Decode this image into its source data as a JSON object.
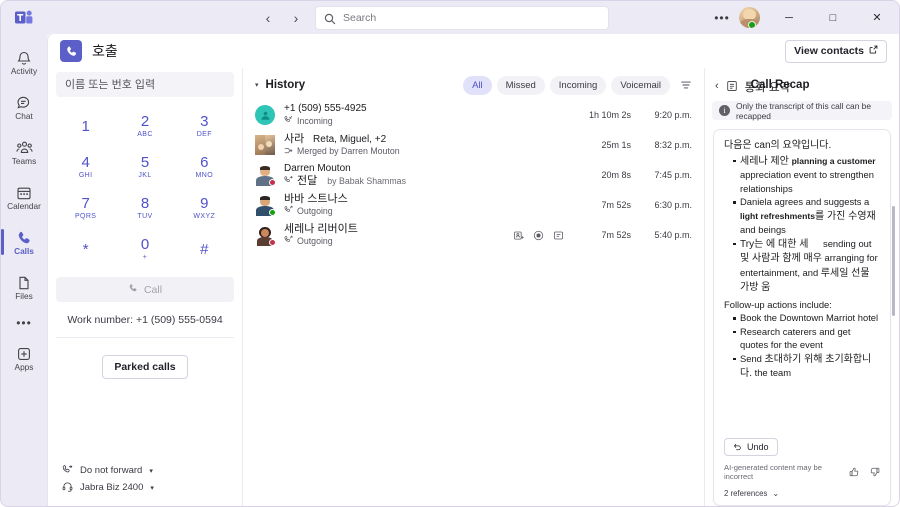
{
  "titlebar": {
    "logo_name": "teams-logo",
    "back_label": "‹",
    "forward_label": "›",
    "search_placeholder": "Search",
    "search_value": "",
    "ellipsis_label": "•••",
    "minimize_label": "─",
    "maximize_label": "□",
    "close_label": "✕"
  },
  "rail": {
    "items": [
      {
        "label": "Activity",
        "icon": "bell-icon",
        "active": false
      },
      {
        "label": "Chat",
        "icon": "chat-icon",
        "active": false
      },
      {
        "label": "Teams",
        "icon": "teams-icon",
        "active": false
      },
      {
        "label": "Calendar",
        "icon": "calendar-icon",
        "active": false
      },
      {
        "label": "Calls",
        "icon": "phone-icon",
        "active": true
      },
      {
        "label": "Files",
        "icon": "file-icon",
        "active": false
      }
    ],
    "more_label": "•••",
    "apps_label": "Apps"
  },
  "app_header": {
    "icon": "phone-icon",
    "title": "호출",
    "view_contacts_label": "View contacts",
    "view_contacts_icon": "open-external-icon"
  },
  "dialpad": {
    "input_placeholder": "이름 또는 번호 입력",
    "input_value": "",
    "keys": [
      {
        "num": "1",
        "sub": ""
      },
      {
        "num": "2",
        "sub": "ABC"
      },
      {
        "num": "3",
        "sub": "DEF"
      },
      {
        "num": "4",
        "sub": "GHI"
      },
      {
        "num": "5",
        "sub": "JKL"
      },
      {
        "num": "6",
        "sub": "MNO"
      },
      {
        "num": "7",
        "sub": "PQRS"
      },
      {
        "num": "8",
        "sub": "TUV"
      },
      {
        "num": "9",
        "sub": "WXYZ"
      },
      {
        "num": "*",
        "sub": ""
      },
      {
        "num": "0",
        "sub": "+"
      },
      {
        "num": "#",
        "sub": ""
      }
    ],
    "call_label": "Call",
    "call_icon": "phone-icon",
    "work_number_label": "Work number: +1 (509) 555-0594",
    "parked_calls_label": "Parked calls",
    "forward_label": "Do not forward",
    "forward_icon": "call-forward-icon",
    "device_label": "Jabra Biz 2400",
    "device_icon": "headset-icon",
    "caret": "▾"
  },
  "history": {
    "title": "History",
    "collapse_caret": "▾",
    "filter_icon": "filter-icon",
    "chips": [
      {
        "label": "All",
        "active": true
      },
      {
        "label": "Missed",
        "active": false
      },
      {
        "label": "Incoming",
        "active": false
      },
      {
        "label": "Voicemail",
        "active": false
      }
    ],
    "rows": [
      {
        "name": "+1 (509) 555-4925",
        "name_extra": "",
        "sub_icon": "incoming-call-icon",
        "sub_ko": "",
        "sub": "Incoming",
        "by": "",
        "duration": "1h 10m 2s",
        "time": "9:20 p.m.",
        "avatar_type": "generic",
        "presence": "",
        "show_actions": false
      },
      {
        "name": "사라",
        "name_extra": "Reta, Miguel, +2",
        "sub_icon": "merged-call-icon",
        "sub_ko": "",
        "sub": "Merged by Darren Mouton",
        "by": "",
        "duration": "25m 1s",
        "time": "8:32 p.m.",
        "avatar_type": "group",
        "presence": "",
        "show_actions": false
      },
      {
        "name": "Darren Mouton",
        "name_extra": "",
        "sub_icon": "forward-call-icon",
        "sub_ko": "전달",
        "sub": "",
        "by": "by Babak Shammas",
        "duration": "20m 8s",
        "time": "7:45 p.m.",
        "avatar_type": "man1",
        "presence": "busy",
        "show_actions": false
      },
      {
        "name": "바바 스트나스",
        "name_extra": "",
        "sub_icon": "outgoing-call-icon",
        "sub_ko": "",
        "sub": "Outgoing",
        "by": "",
        "duration": "7m 52s",
        "time": "6:30 p.m.",
        "avatar_type": "man2",
        "presence": "available",
        "show_actions": false
      },
      {
        "name": "세레나 리버이트",
        "name_extra": "",
        "sub_icon": "outgoing-call-icon",
        "sub_ko": "",
        "sub": "Outgoing",
        "by": "",
        "duration": "7m 52s",
        "time": "5:40 p.m.",
        "avatar_type": "woman1",
        "presence": "busy",
        "show_actions": true,
        "actions": [
          "add-contact-icon",
          "record-icon",
          "chat-icon"
        ]
      }
    ]
  },
  "recap": {
    "back_label": "‹",
    "icon": "recap-icon",
    "title_ko": "통화 요약",
    "title_en": "Call Recap",
    "banner_icon": "info-icon",
    "banner_text": "Only the transcript of this call can be recapped",
    "lead_ko": "다음은 can",
    "lead_ko2": "의 요약입니다.",
    "summary_items": [
      {
        "ko": "세레나 제안 ",
        "bold": "planning a customer",
        "rest": " appreciation event to strengthen relationships"
      },
      {
        "ko": "",
        "bold": "",
        "rest": "Daniela agrees and suggests a ",
        "bold2": "light refreshments",
        "ko2": "를 가진 수영재",
        "rest2": " and beings"
      },
      {
        "ko": "Try는 에 대한 세",
        "bold": "",
        "rest": "sending out",
        "ko2": "및 사람과 함께 매우",
        "rest2": "arranging for entertainment, and",
        "ko3": "루세일 선물 가방 움"
      }
    ],
    "followup_heading": "Follow-up actions include:",
    "followup_items": [
      {
        "text": "Book the Downtown Marriot hotel"
      },
      {
        "text": "Research caterers and get quotes for the event"
      },
      {
        "text": "Send ",
        "ko": "초대하기 위해 초기화합니다.",
        "rest": " the team"
      }
    ],
    "undo_label": "Undo",
    "undo_icon": "undo-icon",
    "ai_disclaimer": "AI-generated content may be incorrect",
    "thumbs_up_icon": "thumbs-up-icon",
    "thumbs_down_icon": "thumbs-down-icon",
    "references_label": "2 references",
    "references_caret": "⌄"
  },
  "colors": {
    "accent": "#5b5fc7",
    "chip_active_bg": "#e2e1fa",
    "available": "#13a10e",
    "busy": "#c4314b",
    "teal": "#2ec4b6"
  }
}
